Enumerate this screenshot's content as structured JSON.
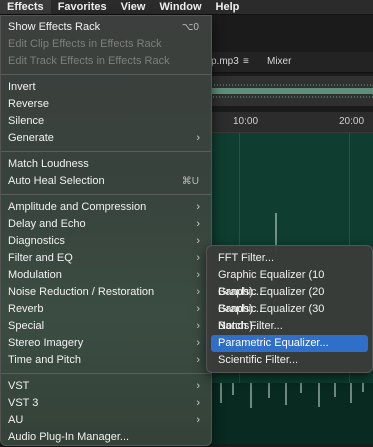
{
  "menubar": {
    "items": [
      "Effects",
      "Favorites",
      "View",
      "Window",
      "Help"
    ]
  },
  "background": {
    "tab_file": "p.mp3",
    "tab_menu_icon": "≡",
    "tab_mixer": "Mixer",
    "ruler": [
      "10:00",
      "20:00"
    ]
  },
  "effects_menu": {
    "show_effects_rack": {
      "label": "Show Effects Rack",
      "shortcut": "⌥0"
    },
    "edit_clip_effects": "Edit Clip Effects in Effects Rack",
    "edit_track_effects": "Edit Track Effects in Effects Rack",
    "invert": "Invert",
    "reverse": "Reverse",
    "silence": "Silence",
    "generate": "Generate",
    "match_loudness": "Match Loudness",
    "auto_heal": {
      "label": "Auto Heal Selection",
      "shortcut": "⌘U"
    },
    "amplitude": "Amplitude and Compression",
    "delay": "Delay and Echo",
    "diagnostics": "Diagnostics",
    "filter_eq": "Filter and EQ",
    "modulation": "Modulation",
    "noise_reduction": "Noise Reduction / Restoration",
    "reverb": "Reverb",
    "special": "Special",
    "stereo": "Stereo Imagery",
    "time_pitch": "Time and Pitch",
    "vst": "VST",
    "vst3": "VST 3",
    "au": "AU",
    "plugin_manager": "Audio Plug-In Manager..."
  },
  "filter_submenu": {
    "items": [
      "FFT Filter...",
      "Graphic Equalizer (10 Bands)...",
      "Graphic Equalizer (20 Bands)...",
      "Graphic Equalizer (30 Bands)...",
      "Notch Filter...",
      "Parametric Equalizer...",
      "Scientific Filter..."
    ],
    "selected": "Parametric Equalizer..."
  },
  "colors": {
    "accent": "#2f6ec9",
    "track_bg": "#0f3e30"
  }
}
